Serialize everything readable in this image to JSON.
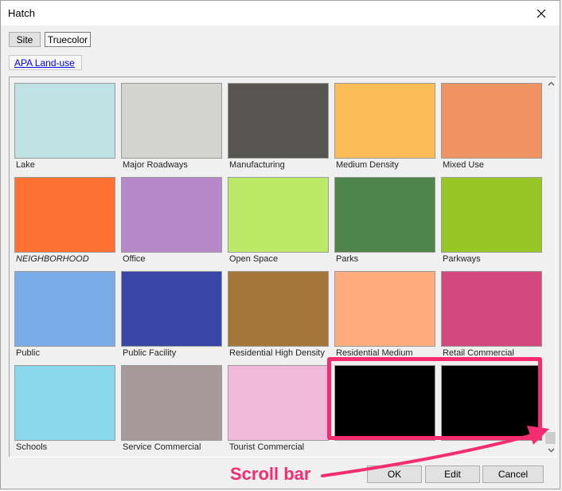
{
  "window": {
    "title": "Hatch"
  },
  "tabs": [
    {
      "label": "Site",
      "active": false
    },
    {
      "label": "Truecolor",
      "active": true
    }
  ],
  "subtab": {
    "label": "APA Land-use"
  },
  "swatches": [
    {
      "label": "Lake",
      "color": "#bfe3e5"
    },
    {
      "label": "Major Roadways",
      "color": "#d3d3cf"
    },
    {
      "label": "Manufacturing",
      "color": "#565551"
    },
    {
      "label": "Medium Density",
      "color": "#fdbc57"
    },
    {
      "label": "Mixed Use",
      "color": "#f09363"
    },
    {
      "label": "NEIGHBORHOOD",
      "color": "#ff7033",
      "italic": true
    },
    {
      "label": "Office",
      "color": "#b588c8"
    },
    {
      "label": "Open Space",
      "color": "#bde968"
    },
    {
      "label": "Parks",
      "color": "#4f844a"
    },
    {
      "label": "Parkways",
      "color": "#99c627"
    },
    {
      "label": "Public",
      "color": "#7aade8"
    },
    {
      "label": "Public Facility",
      "color": "#3a45a8"
    },
    {
      "label": "Residential High Density",
      "color": "#a4763a"
    },
    {
      "label": "Residential Medium",
      "color": "#ffad7e"
    },
    {
      "label": "Retail Commercial",
      "color": "#d4497d"
    },
    {
      "label": "Schools",
      "color": "#8ad6eb"
    },
    {
      "label": "Service Commercial",
      "color": "#a79999"
    },
    {
      "label": "Tourist Commercial",
      "color": "#f2bada"
    },
    {
      "label": "",
      "color": "#000000"
    },
    {
      "label": "",
      "color": "#000000"
    }
  ],
  "buttons": {
    "ok": "OK",
    "edit": "Edit",
    "cancel": "Cancel"
  },
  "annotation": {
    "label": "Scroll bar",
    "color": "#f42d72"
  },
  "icons": {
    "close": "close-icon",
    "scroll_up": "chevron-up-icon",
    "scroll_down": "chevron-down-icon"
  }
}
